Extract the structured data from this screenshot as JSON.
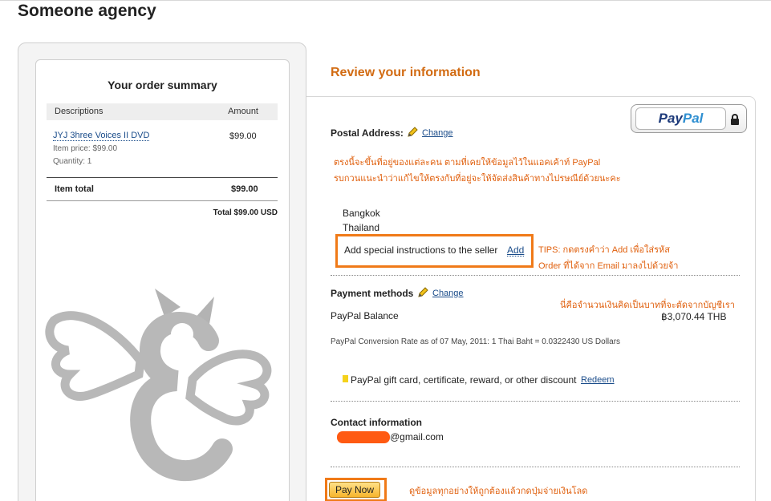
{
  "header": {
    "site_title": "Someone agency"
  },
  "order_summary": {
    "title": "Your order summary",
    "col_descriptions": "Descriptions",
    "col_amount": "Amount",
    "item_name": "JYJ 3hree Voices II DVD",
    "item_amount": "$99.00",
    "item_price": "Item price: $99.00",
    "item_quantity": "Quantity: 1",
    "item_total_label": "Item total",
    "item_total_value": "$99.00",
    "grand_total": "Total $99.00 USD"
  },
  "review": {
    "title": "Review your information",
    "paypal_logo": {
      "pay": "Pay",
      "pal": "Pal"
    },
    "postal_label": "Postal Address:",
    "change_label": "Change",
    "thai_note_1": "ตรงนี้จะขึ้นที่อยู่ของแต่ละคน ตามที่เคยให้ข้อมูลไว้ในแอคเค้าท์ PayPal",
    "thai_note_2": "รบกวนแนะนำว่าแก้ไขให้ตรงกับที่อยู่จะให้จัดส่งสินค้าทางไปรษณีย์ด้วยนะคะ",
    "address_line_1": "Bangkok",
    "address_line_2": "Thailand",
    "special_instructions": "Add special instructions to the seller",
    "add_link": "Add",
    "tips_1": "TIPS: กดตรงคำว่า Add เพื่อใส่รหัส",
    "tips_2": "Order ที่ได้จาก Email มาลงไปด้วยจ้า",
    "payment_label": "Payment methods",
    "payment_thai_note": "นี่คือจำนวนเงินคิดเป็นบาทที่จะตัดจากบัญชีเรา",
    "balance_label": "PayPal Balance",
    "balance_amount": "฿3,070.44 THB",
    "conversion_rate": "PayPal Conversion Rate as of 07 May, 2011: 1 Thai Baht = 0.0322430 US Dollars",
    "gift_text": "PayPal gift card, certificate, reward, or other discount",
    "redeem_link": "Redeem",
    "contact_label": "Contact information",
    "email_suffix": "@gmail.com",
    "pay_now": "Pay Now",
    "pay_thai_note": "ดูข้อมูลทุกอย่างให้ถูกต้องแล้วกดปุ่มจ่ายเงินโลด"
  },
  "colors": {
    "accent_orange": "#d26b12",
    "annotation_orange": "#f07a18",
    "link_blue": "#1a4c8a"
  },
  "icons": [
    "pencil-icon",
    "lock-icon",
    "paypal-logo",
    "agency-logo"
  ]
}
